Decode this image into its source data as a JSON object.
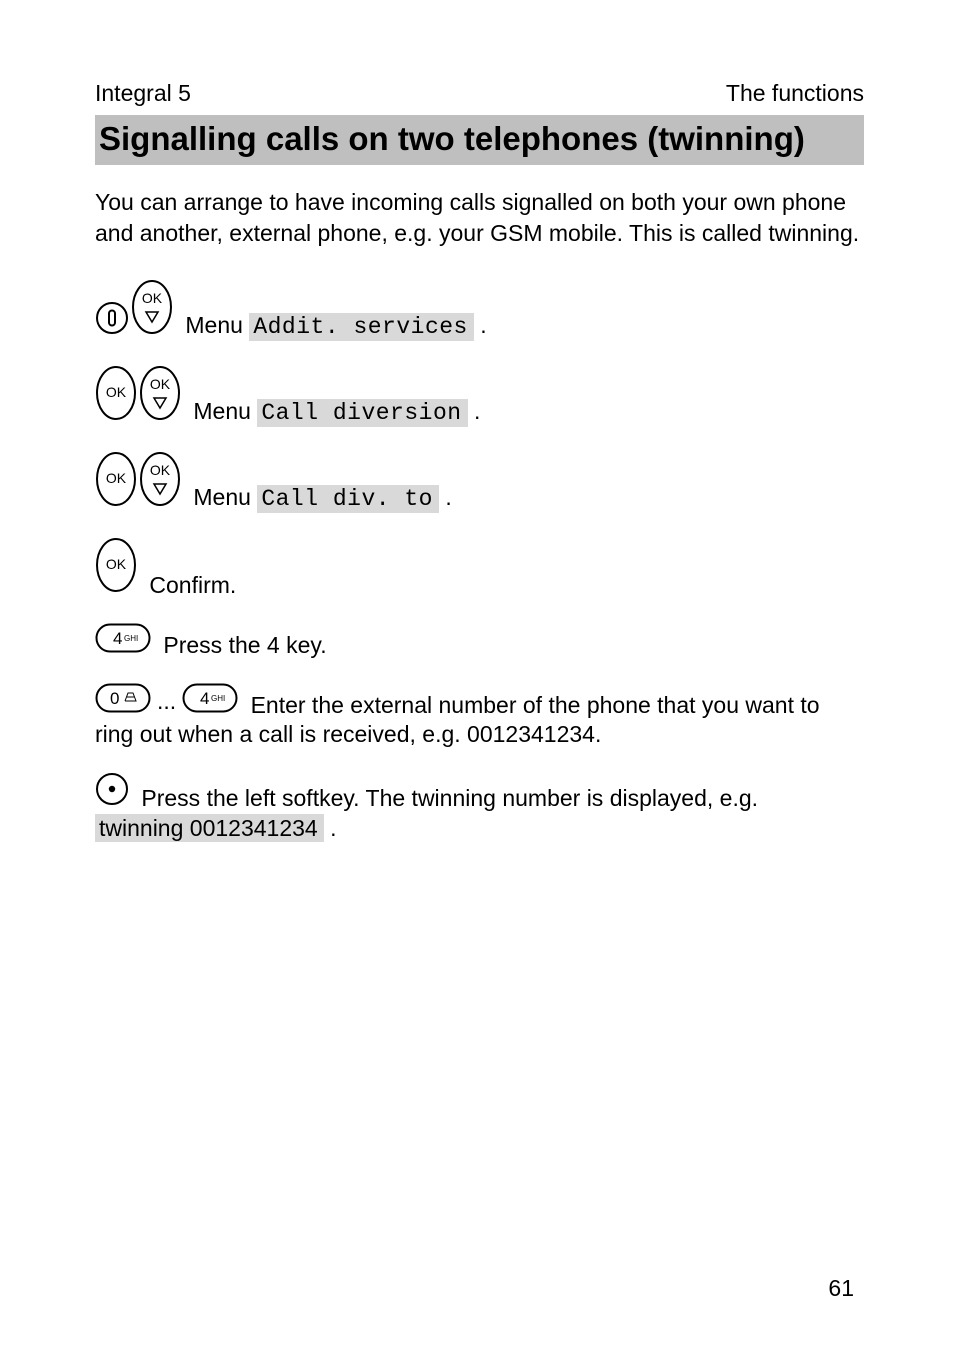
{
  "header": {
    "left": "Integral 5",
    "right": "The functions"
  },
  "title": "Signalling calls on two telephones (twinning)",
  "intro": "You can arrange to have incoming calls signalled on both your own phone and another, external phone, e.g. your GSM mobile. This is called twinning.",
  "steps": {
    "s1_menu_label": "Menu ",
    "s1_hl": "Addit. services",
    "s2_menu_label": "Menu ",
    "s2_hl": "Call diversion",
    "s3_menu_label": "Menu ",
    "s3_hl": "Call div. to",
    "s4_text": "Confirm.",
    "s5_text": "Press the 4 key.",
    "s6_text": "Enter the external number of the phone that you want to ring out when a call is received, e.g. 0012341234.",
    "s7_text": "Press the left softkey. The twinning number is displayed, e.g. ",
    "s7_hl": "twinning 0012341234"
  },
  "dot": " .",
  "ellipsis": "...",
  "page_number": "61"
}
